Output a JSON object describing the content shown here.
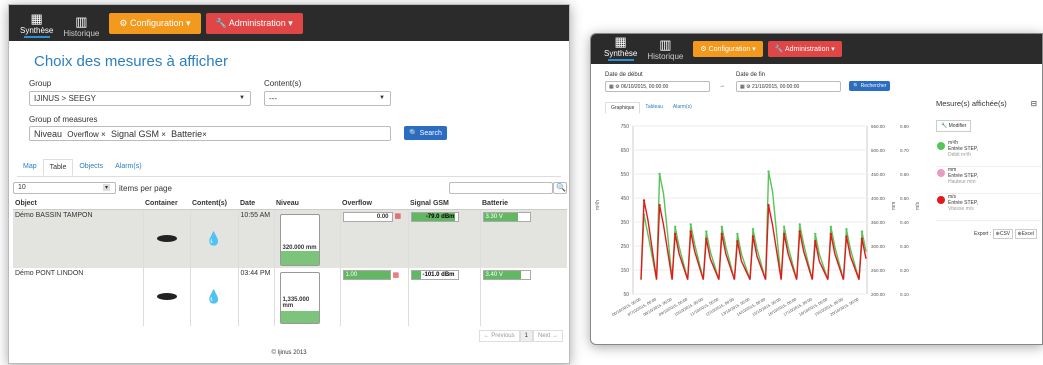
{
  "nav": {
    "tab1": "Synthèse",
    "tab2": "Historique",
    "config": "Configuration ▾",
    "admin": "Administration ▾"
  },
  "form": {
    "title": "Choix des mesures à afficher",
    "group_label": "Group",
    "group_value": "IJINUS > SEEGY",
    "contents_label": "Content(s)",
    "contents_value": "---",
    "gom_label": "Group of measures",
    "tags": [
      "Niveau",
      "Overflow",
      "Signal GSM",
      "Batterie"
    ],
    "search": "Search"
  },
  "tabs": [
    "Map",
    "Table",
    "Objects",
    "Alarm(s)"
  ],
  "table": {
    "per_page": "10",
    "per_page_label": "items per page",
    "headers": [
      "Object",
      "Container",
      "Content(s)",
      "Date",
      "Niveau",
      "Overflow",
      "Signal GSM",
      "Batterie"
    ],
    "rows": [
      {
        "object": "Démo BASSIN TAMPON",
        "date": "10:55 AM",
        "niveau": "320.000 mm",
        "niveau_frac": 0.28,
        "overflow": "0.00",
        "gsm": "-79.0 dBm",
        "gsm_frac": 0.95,
        "battery": "3.30 V",
        "battery_frac": 0.75
      },
      {
        "object": "Démo PONT LINDON",
        "date": "03:44 PM",
        "niveau": "1,335.000 mm",
        "niveau_frac": 0.25,
        "overflow": "1.00",
        "gsm": "-101.0 dBm",
        "gsm_frac": 0.2,
        "battery": "3.40 V",
        "battery_frac": 0.82
      }
    ]
  },
  "pager": {
    "prev": "← Previous",
    "page": "1",
    "next": "Next →"
  },
  "footer": "© Ijinus 2013",
  "win2": {
    "start_label": "Date de début",
    "start_value": "06/10/2015, 00:00:00",
    "end_label": "Date de fin",
    "end_value": "21/10/2015, 00:00:00",
    "search": "Rechercher",
    "tabs": [
      "Graphique",
      "Tableau",
      "Alarm(s)"
    ],
    "side_title": "Mesure(s) affichée(s)",
    "modify": "Modifier",
    "items": [
      {
        "name": "m³/h",
        "sub": "Entrée STEP,",
        "sub2": "Débit m³/h",
        "color": "#57c457"
      },
      {
        "name": "mm",
        "sub": "Entrée STEP,",
        "sub2": "Hauteur mm",
        "color": "#e89cc2"
      },
      {
        "name": "m/s",
        "sub": "Entrée STEP,",
        "sub2": "Vitesse m/s",
        "color": "#e21a1a"
      }
    ],
    "export": "Export :",
    "csv": "CSV",
    "excel": "Excel"
  },
  "chart_data": {
    "type": "line",
    "ylim_left": [
      50,
      750
    ],
    "yticks_left": [
      "750",
      "650",
      "550",
      "450",
      "350",
      "250",
      "150",
      "50"
    ],
    "yticks_mid": [
      "550.00",
      "500.00",
      "450.00",
      "400.00",
      "350.00",
      "300.00",
      "250.00",
      "200.00"
    ],
    "yticks_right": [
      "0.80",
      "0.70",
      "0.60",
      "0.50",
      "0.40",
      "0.30",
      "0.20",
      "0.10"
    ],
    "left_label": "m³/h",
    "mid_label": "mm",
    "right_label": "m/s",
    "x": [
      "06/10/2015, 00:00",
      "07/10/2015, 00:00",
      "08/10/2015, 00:00",
      "09/10/2015, 00:00",
      "10/10/2015, 00:00",
      "11/10/2015, 00:00",
      "12/10/2015, 00:00",
      "13/10/2015, 00:00",
      "14/10/2015, 00:00",
      "15/10/2015, 00:00",
      "16/10/2015, 00:00",
      "17/10/2015, 00:00",
      "18/10/2015, 00:00",
      "19/10/2015, 00:00",
      "20/10/2015, 00:00"
    ],
    "series": [
      {
        "name": "m³/h",
        "color": "#57c457",
        "values": [
          380,
          550,
          330,
          340,
          310,
          330,
          300,
          320,
          560,
          330,
          340,
          300,
          330,
          320,
          310
        ]
      },
      {
        "name": "m/s",
        "color": "#e21a1a",
        "values": [
          440,
          420,
          300,
          310,
          280,
          300,
          270,
          290,
          420,
          300,
          310,
          270,
          300,
          290,
          280
        ]
      }
    ]
  }
}
